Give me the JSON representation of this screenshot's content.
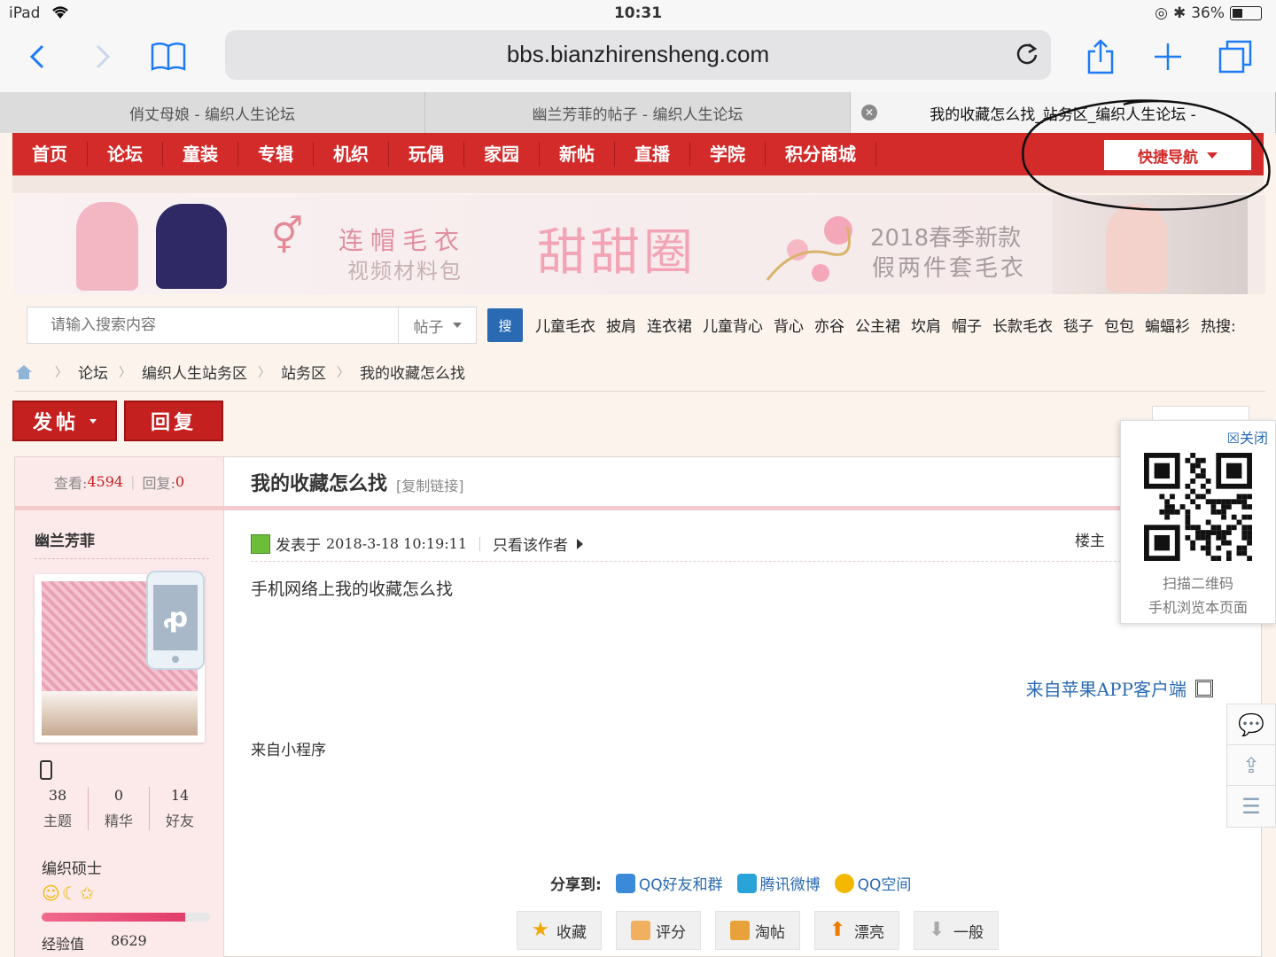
{
  "status": {
    "device": "iPad",
    "time": "10:31",
    "battery": "36%",
    "battery_level": 0.36
  },
  "browser": {
    "url": "bbs.bianzhirensheng.com",
    "tabs": [
      {
        "title": "俏丈母娘 - 编织人生论坛"
      },
      {
        "title": "幽兰芳菲的帖子 - 编织人生论坛"
      },
      {
        "title": "我的收藏怎么找_站务区_编织人生论坛 -"
      }
    ]
  },
  "nav": {
    "items": [
      "首页",
      "论坛",
      "童装",
      "专辑",
      "机织",
      "玩偶",
      "家园",
      "新帖",
      "直播",
      "学院",
      "积分商城"
    ],
    "quick_nav": "快捷导航"
  },
  "banner": {
    "text1": "连帽毛衣",
    "text2": "视频材料包",
    "text3": "甜甜圈",
    "text4": "2018春季新款",
    "text5": "假两件套毛衣"
  },
  "search": {
    "placeholder": "请输入搜索内容",
    "type": "帖子",
    "button": "搜",
    "hot": [
      "儿童毛衣",
      "披肩",
      "连衣裙",
      "儿童背心",
      "背心",
      "亦谷",
      "公主裙",
      "坎肩",
      "帽子",
      "长款毛衣",
      "毯子",
      "包包",
      "蝙蝠衫",
      "热搜:"
    ]
  },
  "breadcrumb": [
    "论坛",
    "编织人生站务区",
    "站务区",
    "我的收藏怎么找"
  ],
  "actions": {
    "post": "发帖",
    "reply": "回复"
  },
  "post": {
    "views_label": "查看:",
    "views": "4594",
    "replies_label": "回复:",
    "replies": "0",
    "title": "我的收藏怎么找",
    "copy_link": "[复制链接]",
    "posted_prefix": "发表于",
    "date": "2018-3-18 10:19:11",
    "only_author": "只看该作者",
    "floor": "楼主",
    "body": "手机网络上我的收藏怎么找",
    "from_app": "来自苹果APP客户端",
    "from_mini": "来自小程序",
    "share_label": "分享到:",
    "share": [
      "QQ好友和群",
      "腾讯微博",
      "QQ空间"
    ],
    "buttons": [
      "收藏",
      "评分",
      "淘帖",
      "漂亮",
      "一般"
    ]
  },
  "author": {
    "name": "幽兰芳菲",
    "stats": [
      {
        "value": "38",
        "label": "主题"
      },
      {
        "value": "0",
        "label": "精华"
      },
      {
        "value": "14",
        "label": "好友"
      }
    ],
    "rank": "编织硕士",
    "stars": "☺☾✩",
    "exp_label": "经验值",
    "exp_value": "8629",
    "exp_progress": 0.85
  },
  "qr_popup": {
    "close": "关闭",
    "line1": "扫描二维码",
    "line2": "手机浏览本页面"
  },
  "colors": {
    "nav_red": "#d32b2a",
    "link_blue": "#2a6ab2",
    "ios_blue": "#1e7bf6"
  }
}
